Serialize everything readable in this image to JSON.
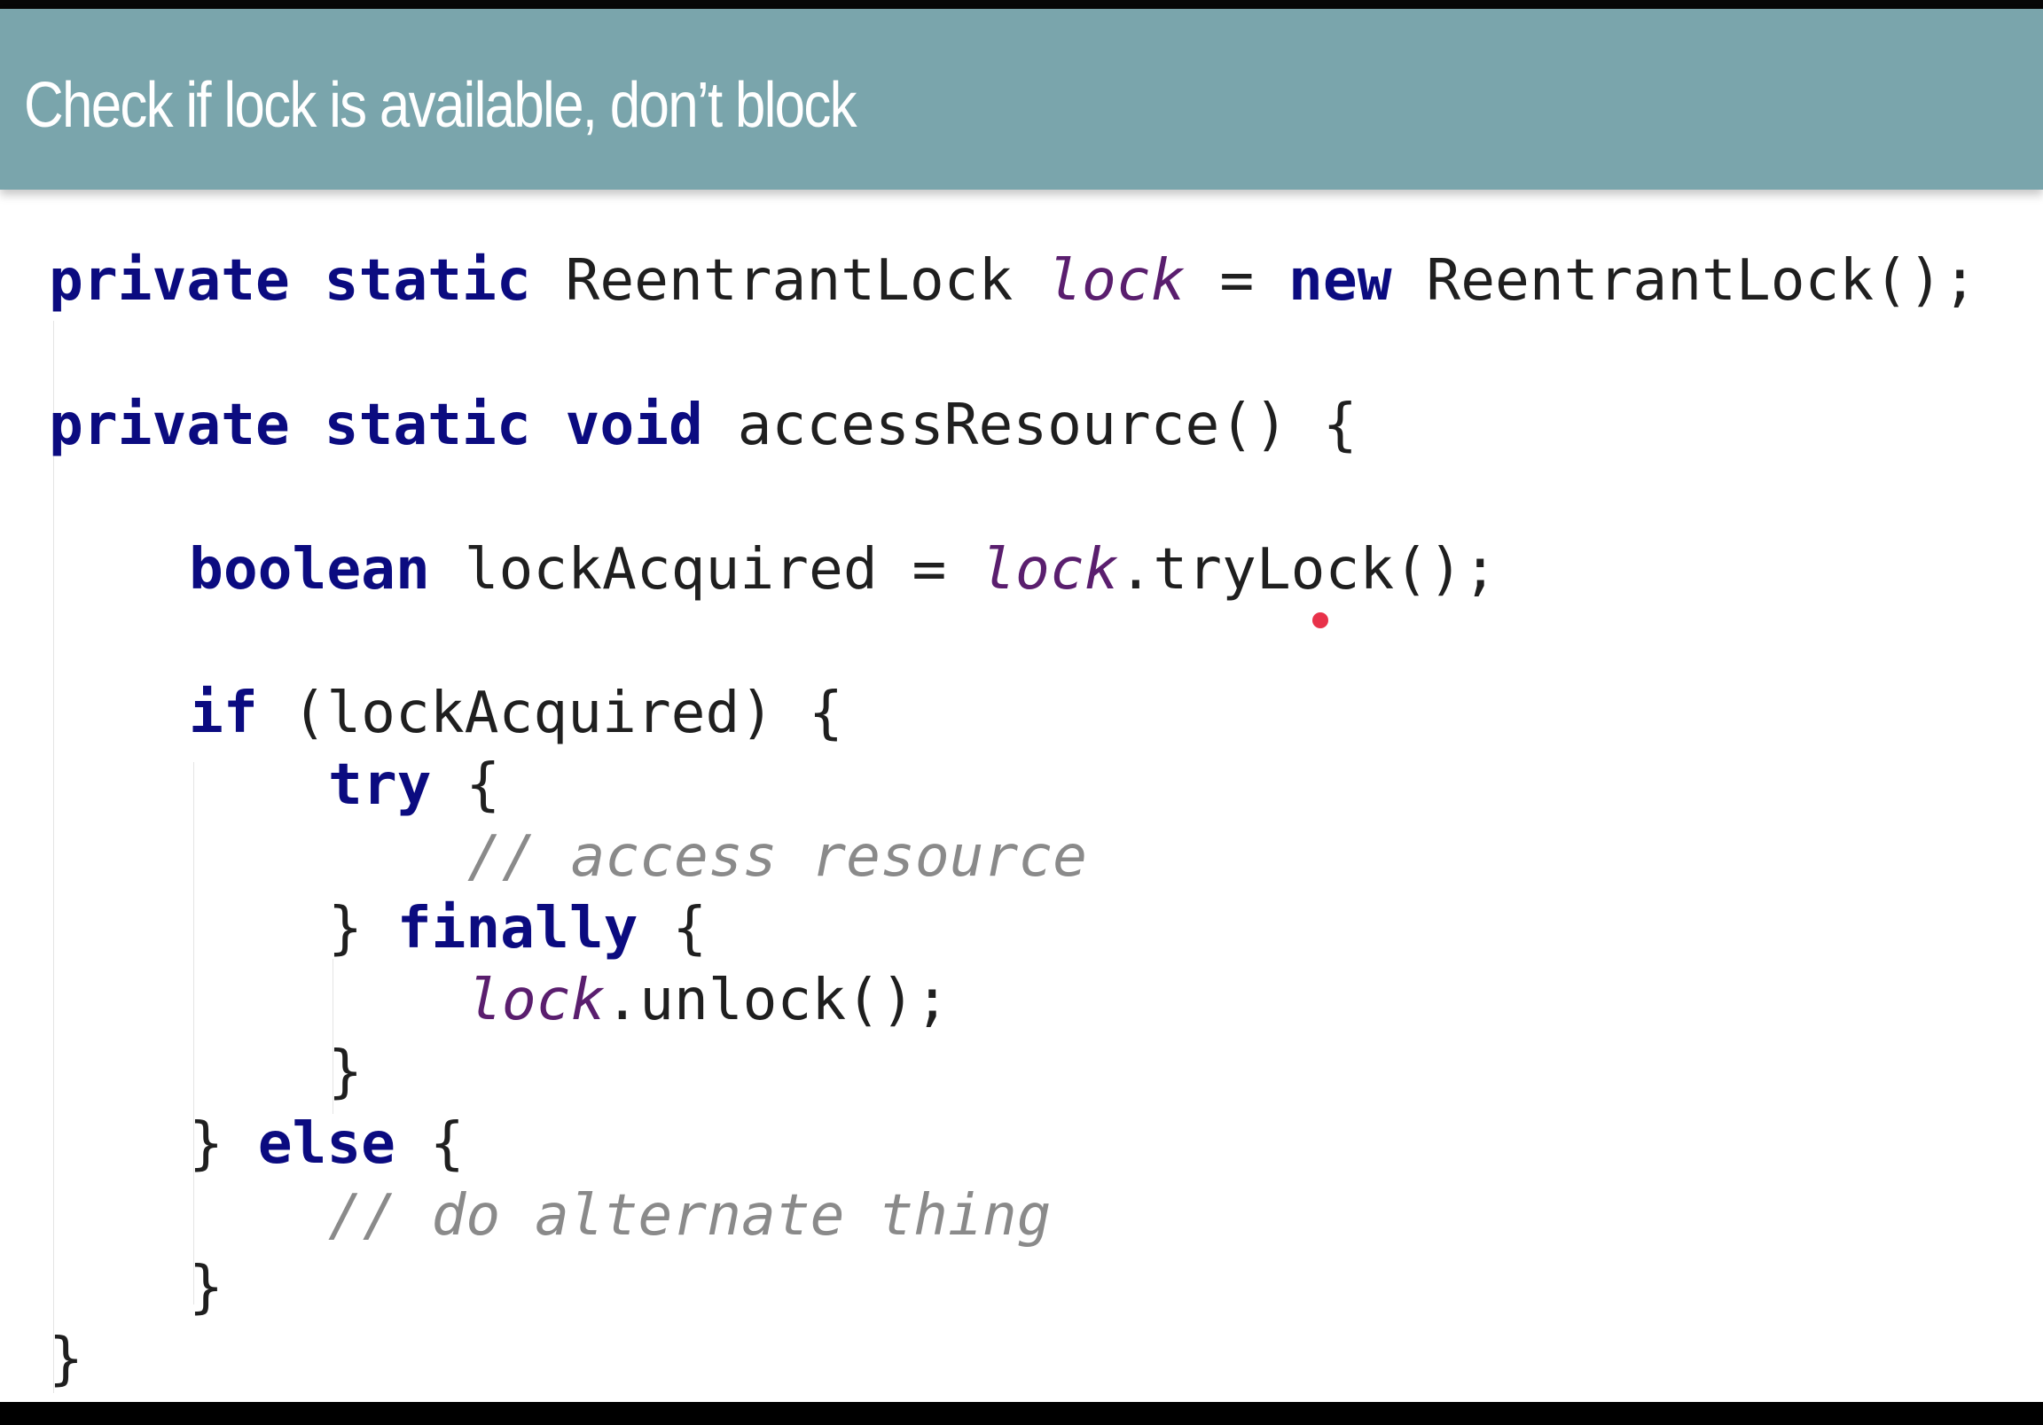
{
  "slide": {
    "title": "Check if lock is available, don’t block"
  },
  "code": {
    "line1": {
      "kw": "private static",
      "type": "ReentrantLock",
      "field": "lock",
      "op": "=",
      "kw_new": "new",
      "rest": "ReentrantLock();"
    },
    "line2": {
      "kw": "private static void",
      "rest": "accessResource() {"
    },
    "line3": {
      "kw": "boolean",
      "var": "lockAcquired =",
      "field": "lock",
      "rest": ".tryLock();"
    },
    "line4": {
      "kw": "if",
      "rest": "(lockAcquired) {"
    },
    "line5": {
      "kw": "try",
      "rest": "{"
    },
    "line6": {
      "comment": "// access resource"
    },
    "line7": {
      "pre": "}",
      "kw": "finally",
      "rest": "{"
    },
    "line8": {
      "field": "lock",
      "rest": ".unlock();"
    },
    "line9": {
      "text": "}"
    },
    "line10": {
      "pre": "}",
      "kw": "else",
      "rest": "{"
    },
    "line11": {
      "comment": "// do alternate thing"
    },
    "line12": {
      "text": "}"
    },
    "line13": {
      "text": "}"
    }
  },
  "colors": {
    "title_bar": "#7aa5ac",
    "keyword": "#0b0b80",
    "field": "#5a1e6e",
    "comment": "#8a8a8a",
    "cursor_dot": "#e8324a"
  }
}
